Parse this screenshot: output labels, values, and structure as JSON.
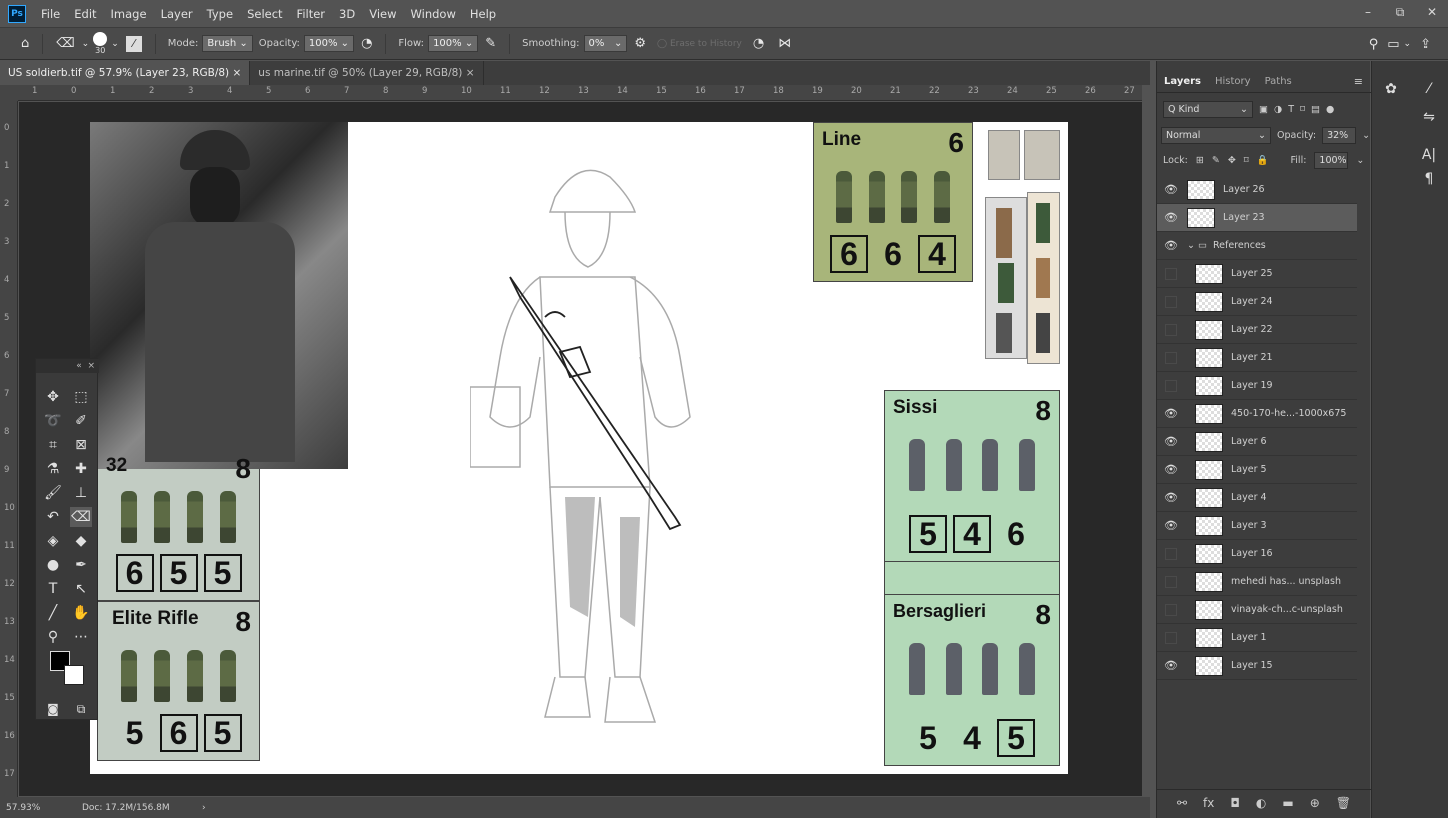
{
  "app": {
    "logo": "Ps"
  },
  "menu": [
    "File",
    "Edit",
    "Image",
    "Layer",
    "Type",
    "Select",
    "Filter",
    "3D",
    "View",
    "Window",
    "Help"
  ],
  "window_controls": [
    "–",
    "⧉",
    "✕"
  ],
  "options_bar": {
    "brush_size": "30",
    "mode_label": "Mode:",
    "mode_value": "Brush",
    "opacity_label": "Opacity:",
    "opacity_value": "100%",
    "flow_label": "Flow:",
    "flow_value": "100%",
    "smoothing_label": "Smoothing:",
    "smoothing_value": "0%",
    "erase_history": "Erase to History"
  },
  "tabs": [
    {
      "label": "US soldierb.tif @ 57.9% (Layer 23, RGB/8) ×"
    },
    {
      "label": "us marine.tif @ 50% (Layer 29, RGB/8) ×"
    }
  ],
  "ruler_h": [
    "1",
    "0",
    "1",
    "2",
    "3",
    "4",
    "5",
    "6",
    "7",
    "8",
    "9",
    "10",
    "11",
    "12",
    "13",
    "14",
    "15",
    "16",
    "17",
    "18",
    "19",
    "20",
    "21",
    "22",
    "23",
    "24",
    "25",
    "26",
    "27"
  ],
  "ruler_v": [
    "0",
    "1",
    "2",
    "3",
    "4",
    "5",
    "6",
    "7",
    "8",
    "9",
    "10",
    "11",
    "12",
    "13",
    "14",
    "15",
    "16",
    "17"
  ],
  "cards": {
    "line": {
      "title": "Line",
      "num": "6",
      "s1": "6",
      "s2": "6",
      "s3": "4"
    },
    "top_left": {
      "num": "8",
      "partial": "32",
      "s1": "6",
      "s2": "5",
      "s3": "5"
    },
    "elite": {
      "title": "Elite Rifle",
      "num": "8",
      "s1": "5",
      "s2": "6",
      "s3": "5"
    },
    "sissi": {
      "title": "Sissi",
      "num": "8",
      "s1": "5",
      "s2": "4",
      "s3": "6"
    },
    "bersaglieri": {
      "title": "Bersaglieri",
      "num": "8",
      "s1": "5",
      "s2": "4",
      "s3": "5"
    }
  },
  "status": {
    "zoom": "57.93%",
    "doc": "Doc: 17.2M/156.8M",
    "arrow": "›"
  },
  "layers_panel": {
    "tabs": [
      "Layers",
      "History",
      "Paths"
    ],
    "kind": "Q Kind",
    "blend": "Normal",
    "opacity_label": "Opacity:",
    "opacity": "32%",
    "lock_label": "Lock:",
    "fill_label": "Fill:",
    "fill": "100%",
    "layers": [
      {
        "name": "Layer 26",
        "visible": true,
        "indent": false,
        "selected": false
      },
      {
        "name": "Layer 23",
        "visible": true,
        "indent": false,
        "selected": true
      },
      {
        "name": "References",
        "visible": true,
        "indent": false,
        "selected": false,
        "group": true
      },
      {
        "name": "Layer 25",
        "visible": false,
        "indent": true,
        "selected": false
      },
      {
        "name": "Layer 24",
        "visible": false,
        "indent": true,
        "selected": false
      },
      {
        "name": "Layer 22",
        "visible": false,
        "indent": true,
        "selected": false
      },
      {
        "name": "Layer 21",
        "visible": false,
        "indent": true,
        "selected": false
      },
      {
        "name": "Layer 19",
        "visible": false,
        "indent": true,
        "selected": false
      },
      {
        "name": "450-170-he...-1000x675",
        "visible": true,
        "indent": true,
        "selected": false
      },
      {
        "name": "Layer 6",
        "visible": true,
        "indent": true,
        "selected": false
      },
      {
        "name": "Layer 5",
        "visible": true,
        "indent": true,
        "selected": false
      },
      {
        "name": "Layer 4",
        "visible": true,
        "indent": true,
        "selected": false
      },
      {
        "name": "Layer 3",
        "visible": true,
        "indent": true,
        "selected": false
      },
      {
        "name": "Layer 16",
        "visible": false,
        "indent": true,
        "selected": false
      },
      {
        "name": "mehedi has... unsplash",
        "visible": false,
        "indent": true,
        "selected": false
      },
      {
        "name": "vinayak-ch...c-unsplash",
        "visible": false,
        "indent": true,
        "selected": false
      },
      {
        "name": "Layer 1",
        "visible": false,
        "indent": true,
        "selected": false
      },
      {
        "name": "Layer 15",
        "visible": true,
        "indent": true,
        "selected": false
      }
    ]
  },
  "icons": {
    "home": "home-icon",
    "eraser": "eraser-icon",
    "brush": "brush-preset-icon",
    "search": "search-icon",
    "share": "share-icon",
    "eye": "eye-icon"
  }
}
